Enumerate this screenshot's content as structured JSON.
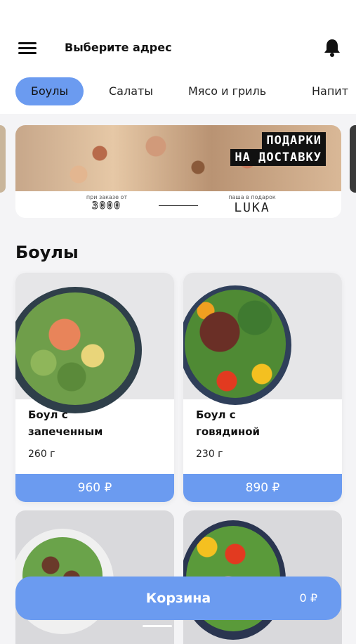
{
  "header": {
    "address": "Выберите адрес",
    "icons": {
      "menu": "hamburger-icon",
      "notifications": "bell-icon"
    }
  },
  "tabs": [
    {
      "label": "Боулы",
      "active": true
    },
    {
      "label": "Салаты",
      "active": false
    },
    {
      "label": "Мясо и гриль",
      "active": false
    },
    {
      "label": "Напит",
      "active": false
    }
  ],
  "banner": {
    "title_line1": "ПОДАРКИ",
    "title_line2": "НА ДОСТАВКУ",
    "left_caption": "при заказе от",
    "left_value": "3000",
    "right_caption": "паша в подарок",
    "right_value": "LUKA"
  },
  "section": {
    "title": "Боулы"
  },
  "products": [
    {
      "name_line1": "Боул с",
      "name_line2": "запеченным",
      "weight": "260 г",
      "price": "960 ₽"
    },
    {
      "name_line1": "Боул с",
      "name_line2": "говядиной",
      "weight": "230 г",
      "price": "890 ₽"
    }
  ],
  "cart": {
    "label": "Корзина",
    "sum": "0 ₽"
  },
  "colors": {
    "accent": "#6b9bf0",
    "background": "#f4f4f6",
    "card": "#ffffff"
  }
}
